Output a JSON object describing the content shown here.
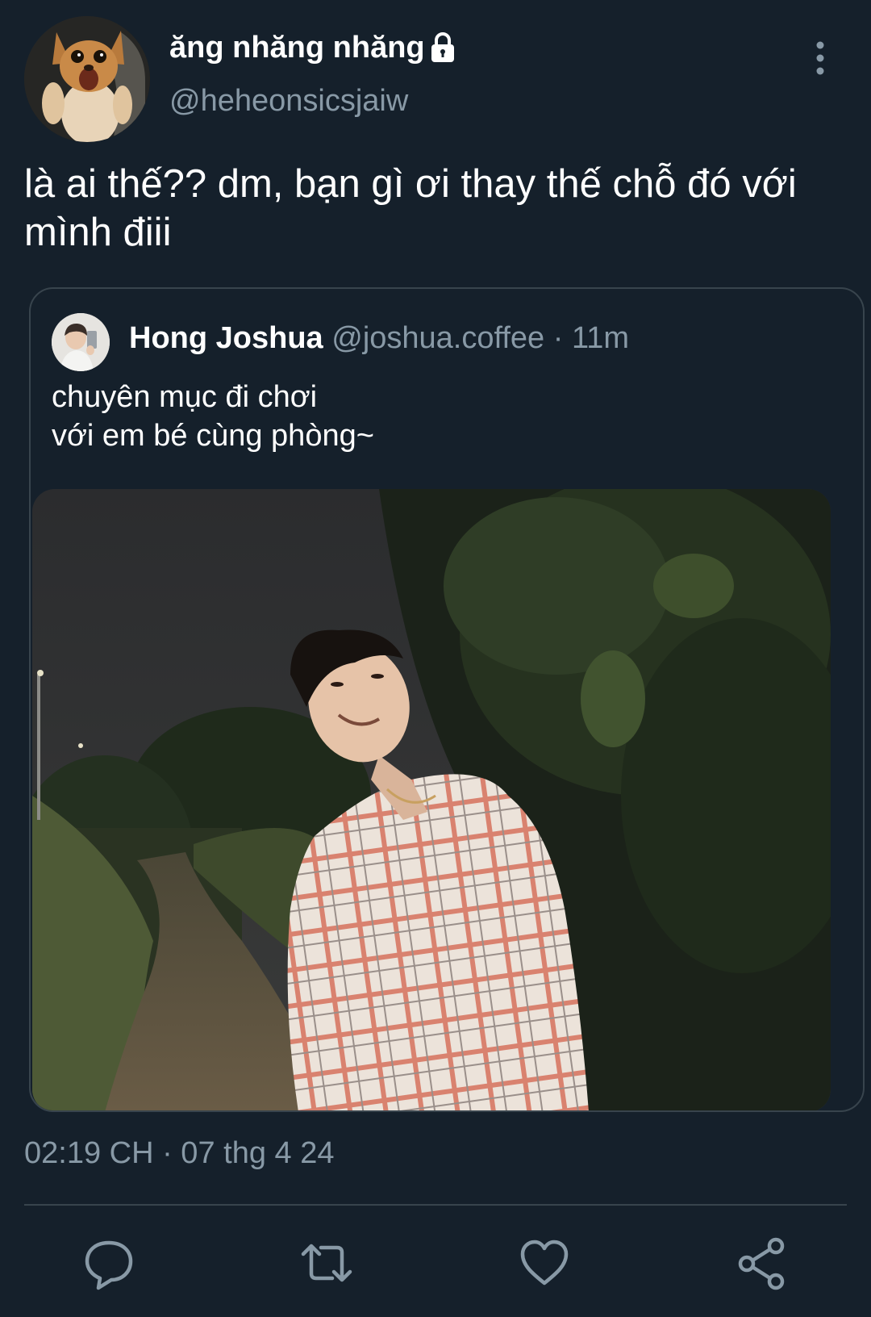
{
  "author": {
    "display_name": "ăng nhăng nhăng",
    "handle": "@heheonsicsjaiw",
    "protected_icon": "lock-icon"
  },
  "tweet": {
    "text": "là ai thế?? dm, bạn gì ơi thay thế chỗ đó với mình điii",
    "timestamp": "02:19 CH · 07 thg 4 24"
  },
  "quoted": {
    "name": "Hong Joshua",
    "handle": "@joshua.coffee",
    "time": "· 11m",
    "text": "chuyên mục đi chơi\nvới em bé cùng phòng~"
  },
  "actions": {
    "icons": [
      "reply-icon",
      "retweet-icon",
      "like-icon",
      "share-icon"
    ]
  },
  "colors": {
    "background": "#15202b",
    "secondary_text": "#8899a6",
    "border": "#38444d"
  }
}
